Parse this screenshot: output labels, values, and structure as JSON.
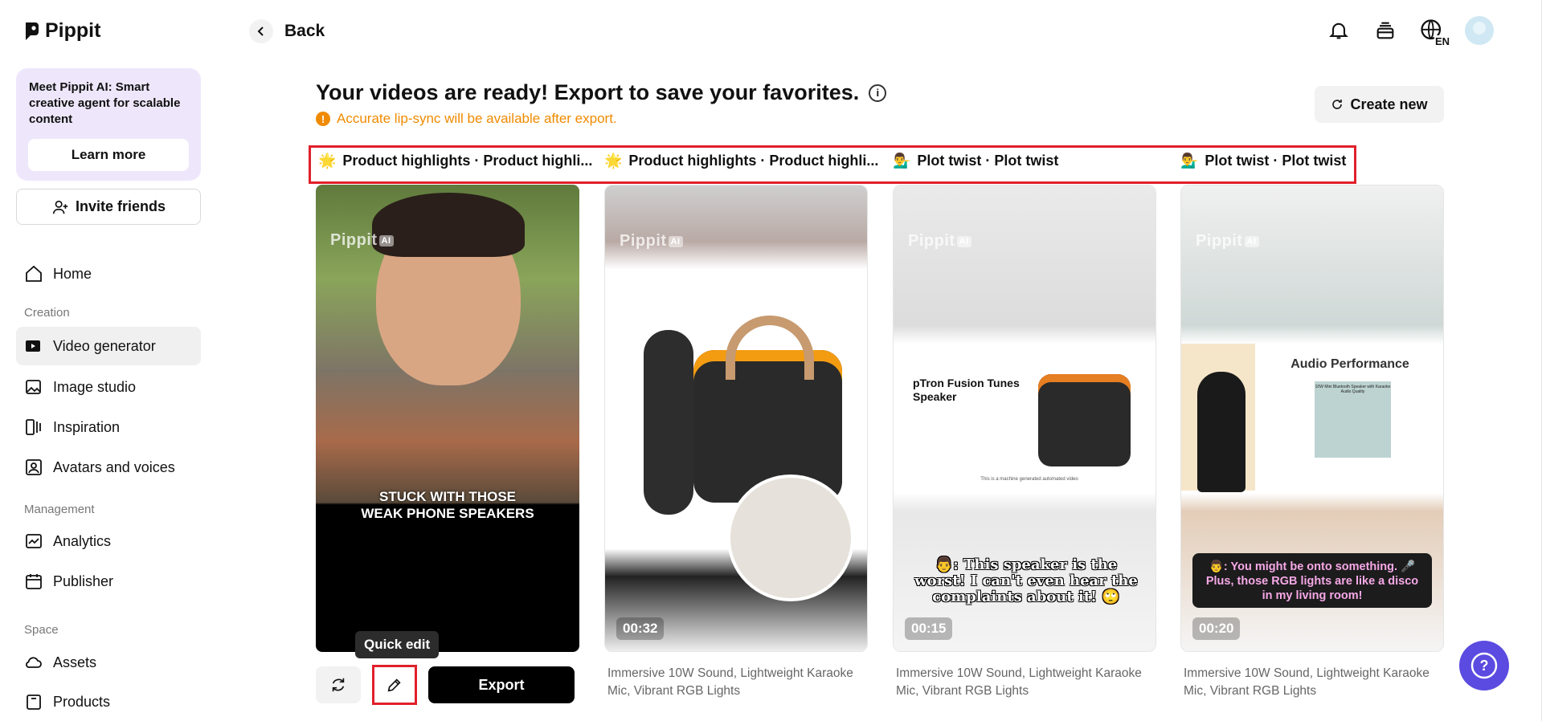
{
  "app": {
    "name": "Pippit"
  },
  "sidebar": {
    "promo_text": "Meet Pippit AI: Smart creative agent for scalable content",
    "learn_more": "Learn more",
    "invite": "Invite friends",
    "home": "Home",
    "creation_label": "Creation",
    "creation_items": [
      "Video generator",
      "Image studio",
      "Inspiration",
      "Avatars and voices"
    ],
    "management_label": "Management",
    "management_items": [
      "Analytics",
      "Publisher"
    ],
    "space_label": "Space",
    "space_items": [
      "Assets",
      "Products"
    ]
  },
  "topbar": {
    "back": "Back",
    "lang_badge": "EN"
  },
  "main": {
    "title": "Your videos are ready! Export to save your favorites.",
    "info_glyph": "i",
    "warning": "Accurate lip-sync will be available after export.",
    "warning_glyph": "!",
    "create_new": "Create new"
  },
  "tabs": [
    {
      "emoji": "🌟",
      "label": "Product highlights · Product highli..."
    },
    {
      "emoji": "🌟",
      "label": "Product highlights · Product highli..."
    },
    {
      "emoji": "💁‍♂️",
      "label": "Plot twist · Plot twist"
    },
    {
      "emoji": "💁‍♂️",
      "label": "Plot twist · Plot twist"
    }
  ],
  "cards": [
    {
      "overlay_line1": "STUCK WITH THOSE",
      "overlay_line2": "WEAK PHONE SPEAKERS",
      "watermark": "Pippit",
      "wm_badge": "AI"
    },
    {
      "duration": "00:32",
      "caption": "Immersive 10W Sound, Lightweight Karaoke Mic, Vibrant RGB Lights",
      "watermark": "Pippit",
      "wm_badge": "AI"
    },
    {
      "duration": "00:15",
      "caption": "Immersive 10W Sound, Lightweight Karaoke Mic, Vibrant RGB Lights",
      "watermark": "Pippit",
      "wm_badge": "AI",
      "product_title": "pTron Fusion Tunes Speaker",
      "footnote": "This is a machine generated automated video",
      "subtitle": "👨: This speaker is the worst! I can't even hear the complaints about it! 🙄"
    },
    {
      "duration": "00:20",
      "caption": "Immersive 10W Sound, Lightweight Karaoke Mic, Vibrant RGB Lights",
      "watermark": "Pippit",
      "wm_badge": "AI",
      "panel_title": "Audio Performance",
      "box_text": "10W Mini Bluetooth Speaker with Karaoke Audio Quality",
      "subtitle": "👨: You might be onto something. 🎤 Plus, those RGB lights are like a disco in my living room!"
    }
  ],
  "actions": {
    "quick_edit_tooltip": "Quick edit",
    "export": "Export"
  },
  "help_glyph": "?",
  "colors": {
    "accent": "#5b4be0",
    "warning": "#f08a00",
    "highlight_border": "#e0202a",
    "promo_bg": "#eee7fb"
  }
}
